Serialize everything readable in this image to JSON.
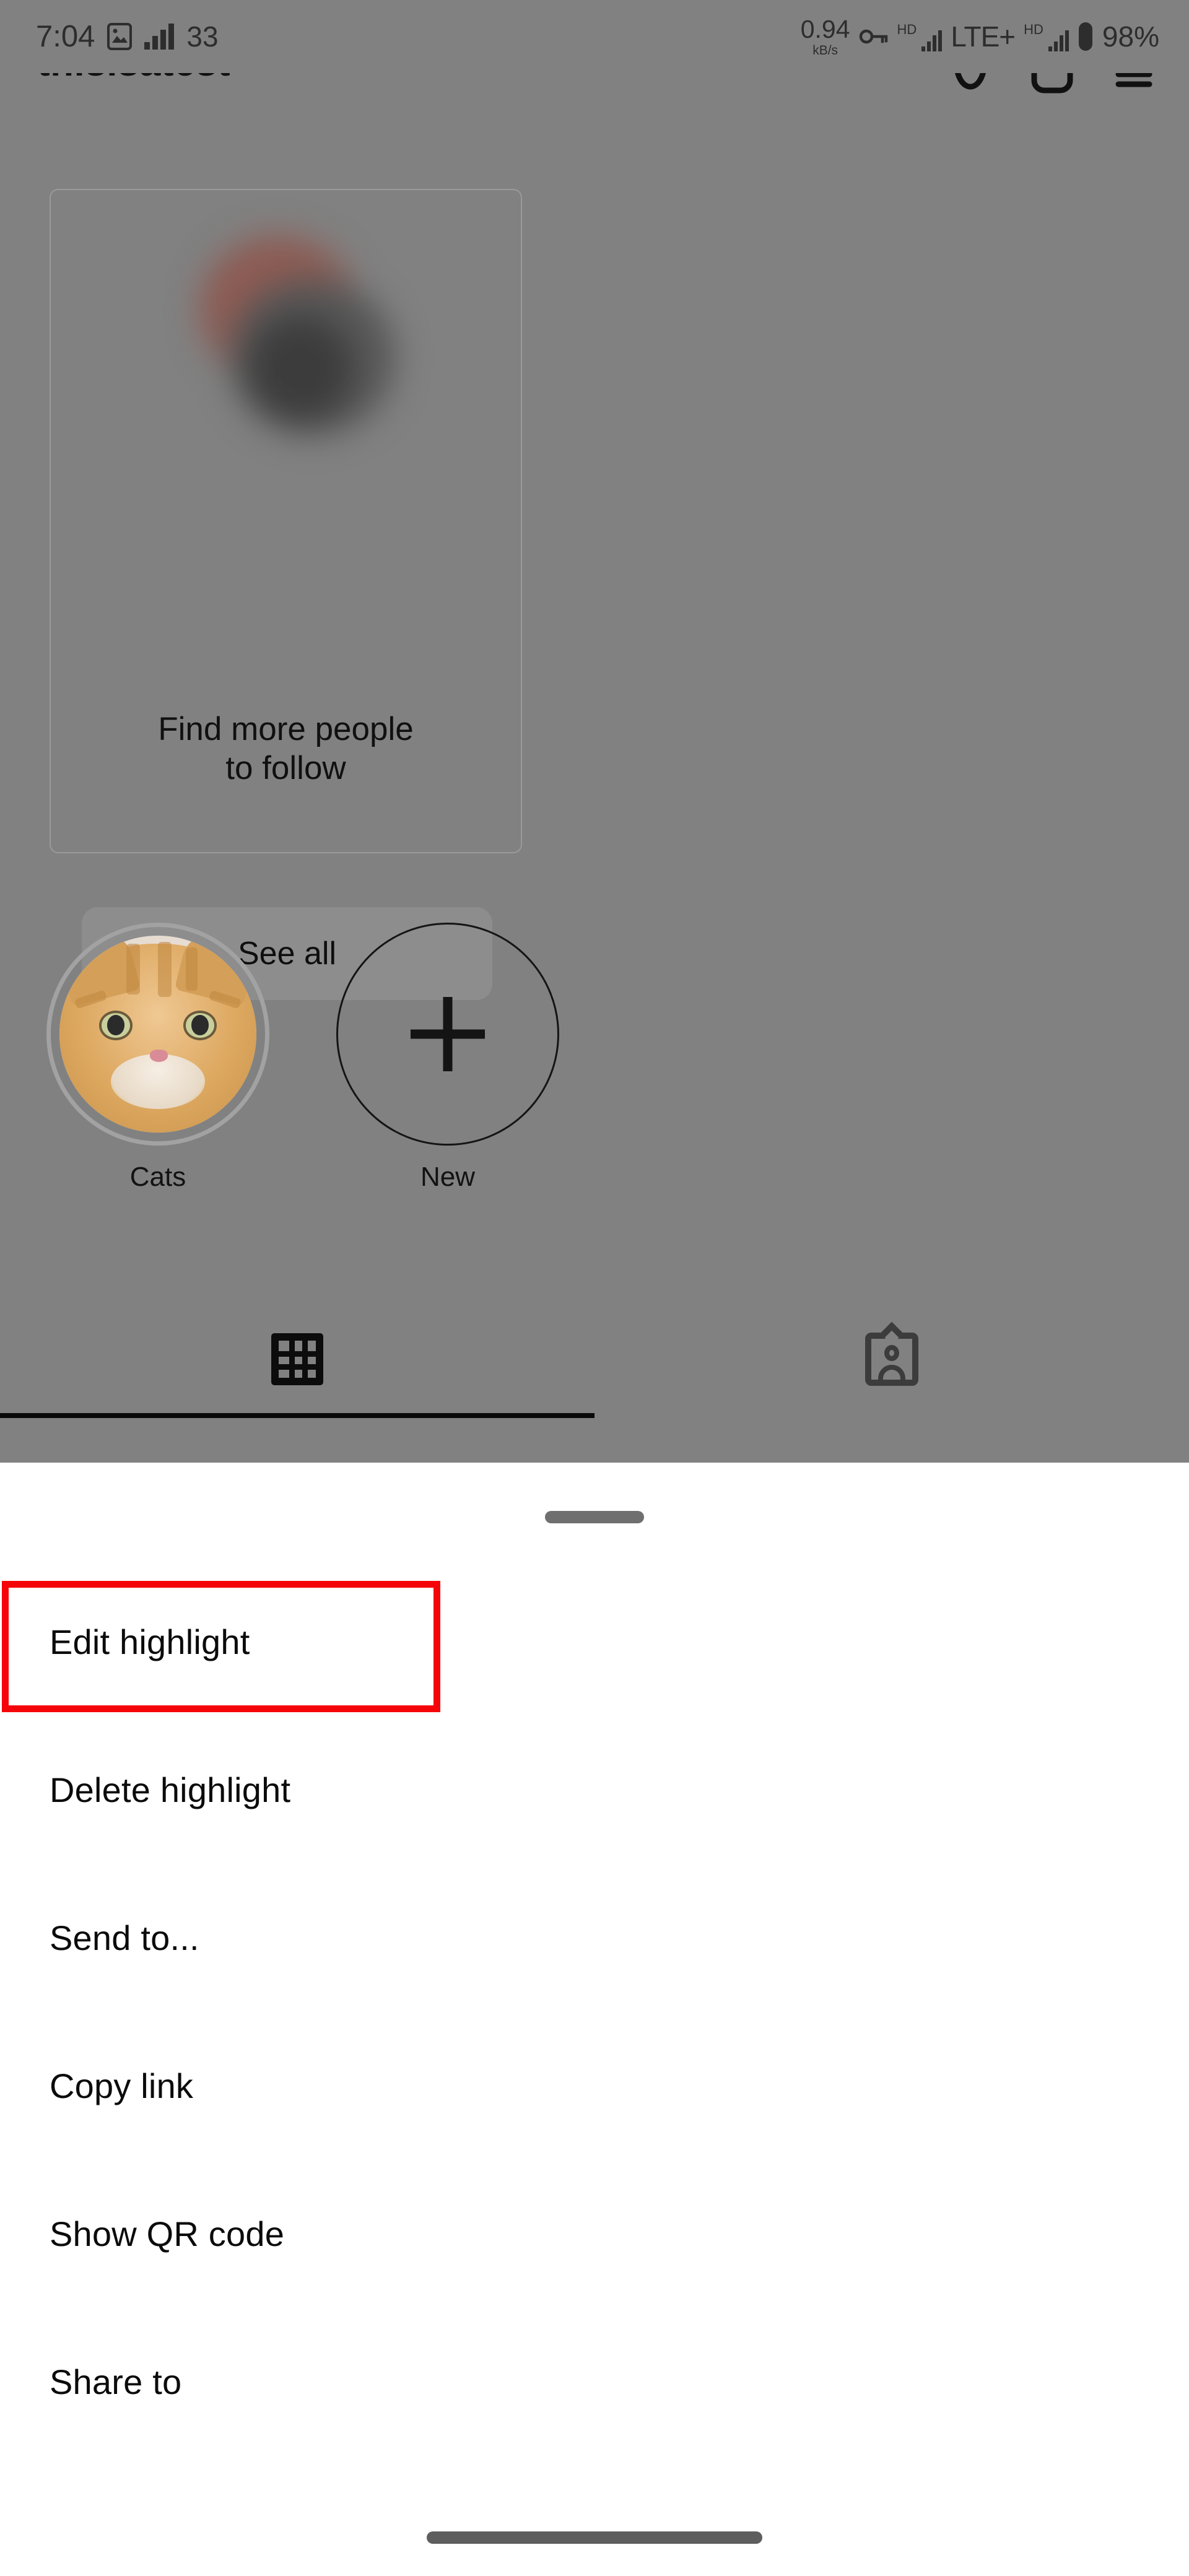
{
  "status_bar": {
    "time": "7:04",
    "screenshot_icon": "image-icon",
    "signal_icon": "signal-bars-icon",
    "notification_count": "33",
    "net_speed_value": "0.94",
    "net_speed_unit": "kB/s",
    "vpn_icon": "key-icon",
    "sim1_hd": "HD",
    "network_type": "LTE+",
    "sim2_hd": "HD",
    "battery_icon": "battery-icon",
    "battery_percent": "98%"
  },
  "clipped_header": {
    "title": "thisisatest",
    "icons": [
      "threads-icon",
      "add-post-icon",
      "menu-icon"
    ]
  },
  "suggestion_card": {
    "avatar": "blurred-avatar",
    "title": "Find more people\nto follow",
    "see_all_label": "See all"
  },
  "highlights": [
    {
      "label": "Cats",
      "thumb": "cat-photo",
      "type": "highlight"
    },
    {
      "label": "New",
      "thumb": "plus-icon",
      "type": "new"
    }
  ],
  "profile_tabs": [
    {
      "name": "grid",
      "icon": "grid-icon",
      "active": true
    },
    {
      "name": "tagged",
      "icon": "tagged-photos-icon",
      "active": false
    }
  ],
  "bottom_sheet": {
    "handle": "drag-handle",
    "menu_items": [
      {
        "label": "Edit highlight",
        "annotated": true
      },
      {
        "label": "Delete highlight",
        "annotated": false
      },
      {
        "label": "Send to...",
        "annotated": false
      },
      {
        "label": "Copy link",
        "annotated": false
      },
      {
        "label": "Show QR code",
        "annotated": false
      },
      {
        "label": "Share to",
        "annotated": false
      }
    ]
  },
  "annotation": {
    "color": "#f5040a",
    "target": "Edit highlight"
  },
  "colors": {
    "scrim": "#818181",
    "sheet_bg": "#ffffff",
    "text": "#0b0b0b",
    "accent_underline": "#0a0a0a",
    "annotation_red": "#f5040a"
  },
  "gesture_nav": {
    "pill": "home-indicator"
  }
}
